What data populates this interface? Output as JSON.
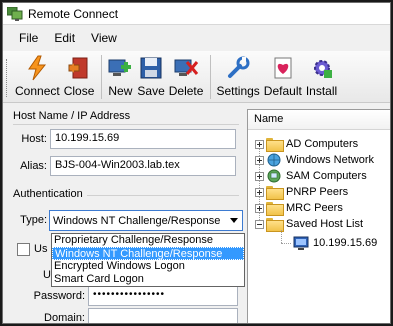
{
  "window": {
    "title": "Remote Connect"
  },
  "menu": {
    "items": [
      "File",
      "Edit",
      "View"
    ]
  },
  "toolbar": {
    "buttons": [
      {
        "label": "Connect",
        "icon": "lightning-icon"
      },
      {
        "label": "Close",
        "icon": "close-door-icon"
      },
      {
        "label": "New",
        "icon": "new-computer-icon"
      },
      {
        "label": "Save",
        "icon": "floppy-disk-icon"
      },
      {
        "label": "Delete",
        "icon": "delete-computer-icon"
      },
      {
        "label": "Settings",
        "icon": "wrench-icon"
      },
      {
        "label": "Default",
        "icon": "default-heart-icon"
      },
      {
        "label": "Install",
        "icon": "install-gear-icon"
      }
    ]
  },
  "host_section": {
    "heading": "Host Name / IP Address",
    "host_label": "Host:",
    "host_value": "10.199.15.69",
    "alias_label": "Alias:",
    "alias_value": "BJS-004-Win2003.lab.tex"
  },
  "auth_section": {
    "heading": "Authentication",
    "type_label": "Type:",
    "type_value": "Windows NT Challenge/Response",
    "options": [
      "Proprietary Challenge/Response",
      "Windows NT Challenge/Response",
      "Encrypted Windows Logon",
      "Smart Card Logon"
    ],
    "selected_index": 1,
    "use_checkbox_label": "Us",
    "user_label": "U",
    "password_label": "Password:",
    "password_value": "••••••••••••••••",
    "domain_label": "Domain:",
    "domain_value": ""
  },
  "tree": {
    "header": "Name",
    "items": [
      {
        "label": "AD Computers",
        "icon": "ad-folder-icon"
      },
      {
        "label": "Windows Network",
        "icon": "network-globe-icon"
      },
      {
        "label": "SAM Computers",
        "icon": "sam-network-icon"
      },
      {
        "label": "PNRP Peers",
        "icon": "folder-icon"
      },
      {
        "label": "MRC Peers",
        "icon": "folder-icon"
      },
      {
        "label": "Saved Host List",
        "icon": "folder-open-icon"
      }
    ],
    "child": {
      "label": "10.199.15.69",
      "icon": "computer-icon"
    }
  }
}
